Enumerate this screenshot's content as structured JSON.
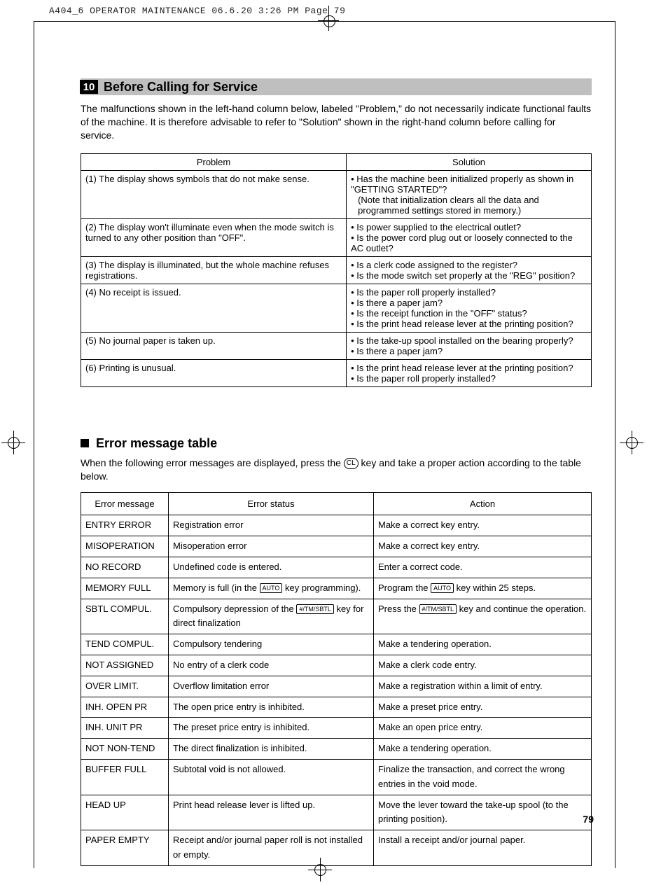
{
  "print_header": "A404_6 OPERATOR MAINTENANCE  06.6.20 3:26 PM  Page 79",
  "section": {
    "number": "10",
    "title": "Before Calling for Service",
    "intro": "The malfunctions shown in the left-hand column below, labeled \"Problem,\" do not necessarily indicate functional faults of the machine.  It is therefore advisable to refer to \"Solution\" shown in the right-hand column before calling for service."
  },
  "troubleshoot": {
    "headers": {
      "problem": "Problem",
      "solution": "Solution"
    },
    "rows": [
      {
        "problem": "(1) The display shows symbols that do not make sense.",
        "solutions": [
          "Has the machine been initialized properly as shown in \"GETTING STARTED\"?",
          "(Note that initialization clears all the data and programmed settings stored in memory.)"
        ],
        "note_index": 1
      },
      {
        "problem": "(2) The display won't illuminate even when the mode switch is turned to any other position than \"OFF\".",
        "solutions": [
          "Is power supplied to the electrical outlet?",
          "Is the power cord plug out or loosely connected to the AC outlet?"
        ]
      },
      {
        "problem": "(3) The display is illuminated, but the whole machine refuses registrations.",
        "solutions": [
          "Is a clerk code assigned to the register?",
          "Is the mode switch set properly at the \"REG\" position?"
        ]
      },
      {
        "problem": "(4) No receipt is issued.",
        "solutions": [
          "Is the paper roll properly installed?",
          "Is there a paper jam?",
          "Is the receipt function in the \"OFF\" status?",
          "Is the print head release lever at the printing position?"
        ]
      },
      {
        "problem": "(5) No journal paper is taken up.",
        "solutions": [
          "Is the take-up spool installed on the bearing properly?",
          "Is there a paper jam?"
        ]
      },
      {
        "problem": "(6) Printing is unusual.",
        "solutions": [
          "Is the print head release lever at the printing position?",
          "Is the paper roll properly installed?"
        ]
      }
    ]
  },
  "error_section": {
    "title": "Error message table",
    "intro_before_key": "When the following error messages are displayed, press the ",
    "key_label": "CL",
    "intro_after_key": " key and take a proper action according to the table below.",
    "headers": {
      "message": "Error message",
      "status": "Error status",
      "action": "Action"
    },
    "keycaps": {
      "auto": "AUTO",
      "tmsbtl": "#/TM/SBTL"
    },
    "rows": [
      {
        "msg": "ENTRY ERROR",
        "status": "Registration error",
        "action": "Make a correct key entry."
      },
      {
        "msg": "MISOPERATION",
        "status": "Misoperation error",
        "action": "Make a correct key entry."
      },
      {
        "msg": "NO RECORD",
        "status": "Undefined code is entered.",
        "action": "Enter a correct code."
      },
      {
        "msg": "MEMORY FULL",
        "status_pre": "Memory is full (in the ",
        "status_key": "auto",
        "status_post": " key programming).",
        "action_pre": "Program the ",
        "action_key": "auto",
        "action_post": " key within 25 steps."
      },
      {
        "msg": "SBTL COMPUL.",
        "status_pre": "Compulsory depression of the ",
        "status_key": "tmsbtl",
        "status_post": " key for direct finalization",
        "action_pre": "Press the ",
        "action_key": "tmsbtl",
        "action_post": " key and continue the operation."
      },
      {
        "msg": "TEND COMPUL.",
        "status": "Compulsory tendering",
        "action": "Make a tendering operation."
      },
      {
        "msg": "NOT ASSIGNED",
        "status": "No entry of a clerk code",
        "action": "Make a clerk code entry."
      },
      {
        "msg": "OVER LIMIT.",
        "status": "Overflow limitation error",
        "action": "Make a registration within a limit of entry."
      },
      {
        "msg": "INH. OPEN PR",
        "status": "The open price entry is inhibited.",
        "action": "Make a preset price entry."
      },
      {
        "msg": "INH. UNIT PR",
        "status": "The preset price entry is inhibited.",
        "action": "Make an open price entry."
      },
      {
        "msg": "NOT NON-TEND",
        "status": "The direct finalization is inhibited.",
        "action": "Make a tendering operation."
      },
      {
        "msg": "BUFFER FULL",
        "status": "Subtotal void is not allowed.",
        "action": "Finalize the transaction, and correct the wrong entries in the void mode."
      },
      {
        "msg": "HEAD UP",
        "status": "Print head release lever is lifted up.",
        "action": "Move the lever toward the take-up spool (to the printing position)."
      },
      {
        "msg": "PAPER EMPTY",
        "status": "Receipt and/or journal paper roll is not installed or empty.",
        "action": "Install a receipt and/or journal paper."
      }
    ]
  },
  "page_number": "79"
}
